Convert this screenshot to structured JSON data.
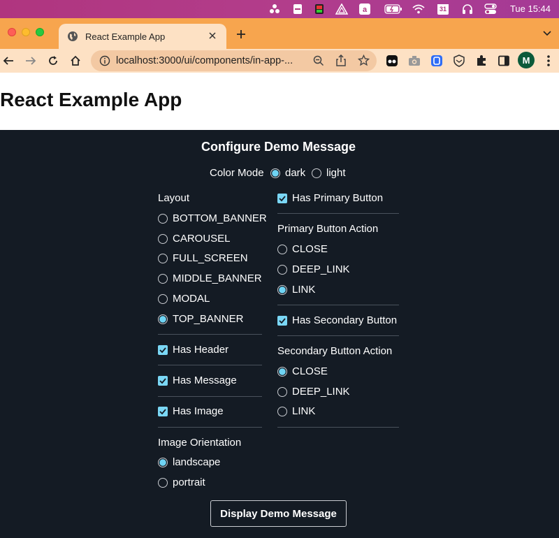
{
  "menubar": {
    "icons": [
      "dots-icon",
      "document-icon",
      "battery-status-icon",
      "triangle-icon",
      "amazon-icon",
      "battery-icon",
      "wifi-icon",
      "calendar-icon",
      "headphones-icon",
      "control-center-icon"
    ],
    "calendar_day": "31",
    "clock": "Tue 15:44"
  },
  "browser": {
    "tab_title": "React Example App",
    "url": "localhost:3000/ui/components/in-app-...",
    "avatar_letter": "M"
  },
  "page": {
    "title": "React Example App"
  },
  "config": {
    "title": "Configure Demo Message",
    "color_mode": {
      "label": "Color Mode",
      "options": [
        "dark",
        "light"
      ],
      "selected": "dark"
    },
    "layout": {
      "label": "Layout",
      "options": [
        "BOTTOM_BANNER",
        "CAROUSEL",
        "FULL_SCREEN",
        "MIDDLE_BANNER",
        "MODAL",
        "TOP_BANNER"
      ],
      "selected": "TOP_BANNER"
    },
    "has_header": {
      "label": "Has Header",
      "checked": true
    },
    "has_message": {
      "label": "Has Message",
      "checked": true
    },
    "has_image": {
      "label": "Has Image",
      "checked": true
    },
    "image_orientation": {
      "label": "Image Orientation",
      "options": [
        "landscape",
        "portrait"
      ],
      "selected": "landscape"
    },
    "has_primary_button": {
      "label": "Has Primary Button",
      "checked": true
    },
    "primary_button_action": {
      "label": "Primary Button Action",
      "options": [
        "CLOSE",
        "DEEP_LINK",
        "LINK"
      ],
      "selected": "LINK"
    },
    "has_secondary_button": {
      "label": "Has Secondary Button",
      "checked": true
    },
    "secondary_button_action": {
      "label": "Secondary Button Action",
      "options": [
        "CLOSE",
        "DEEP_LINK",
        "LINK"
      ],
      "selected": "CLOSE"
    },
    "display_button": "Display Demo Message"
  },
  "colors": {
    "panel_bg": "#141b24",
    "accent": "#6fd4f4",
    "tab_strip": "#f7a54e",
    "toolbar": "#fde1c4",
    "menubar": "#b0357f"
  }
}
